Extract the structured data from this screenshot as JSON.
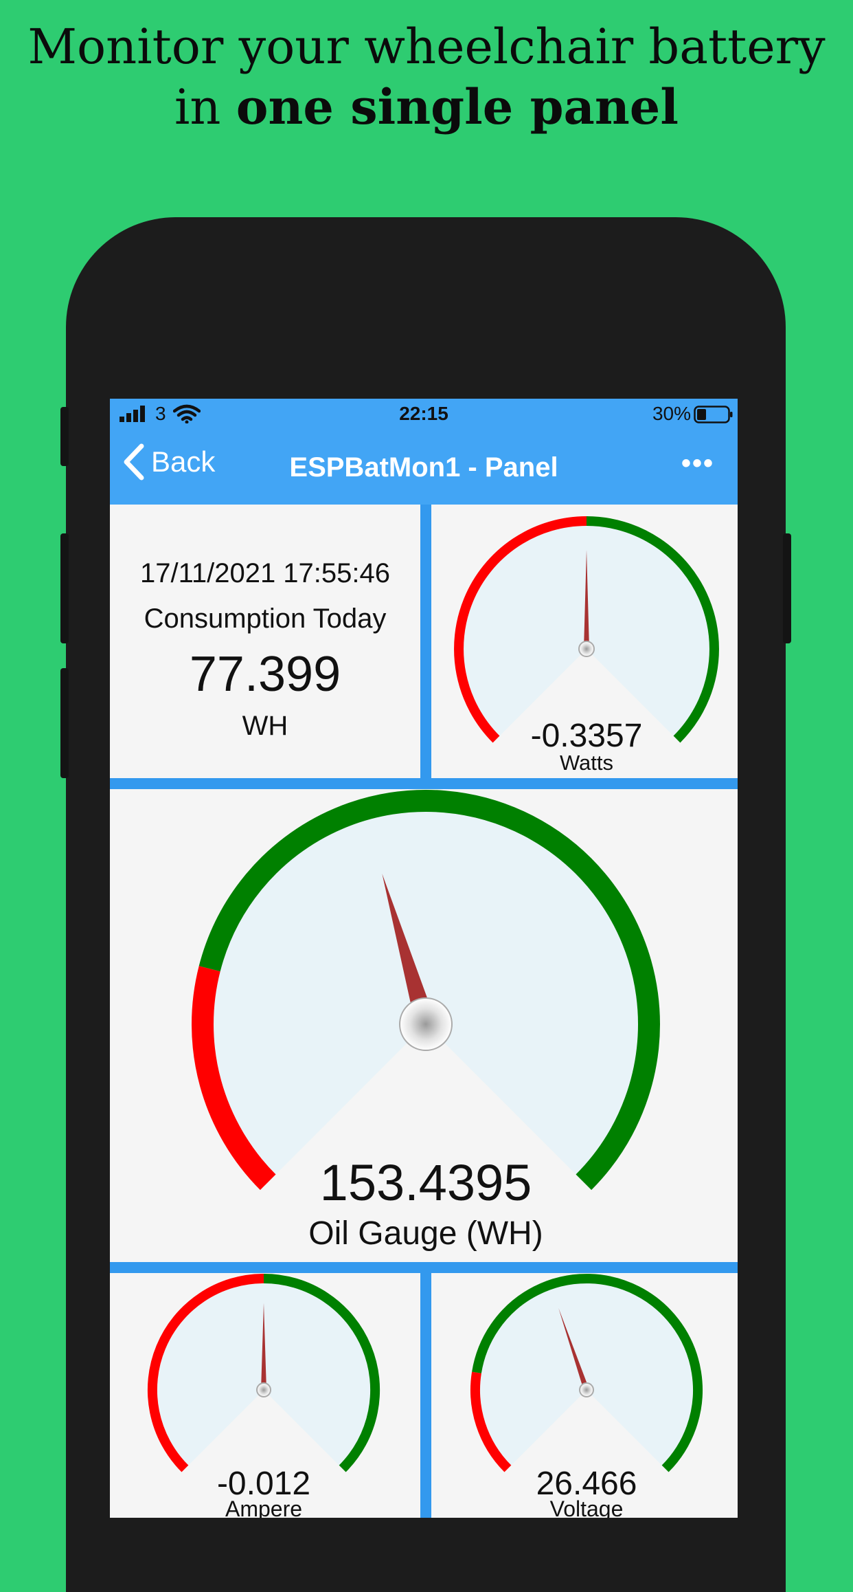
{
  "headline": {
    "line1": "Monitor your wheelchair battery",
    "line2_prefix": "in ",
    "line2_bold": "one single panel"
  },
  "status_bar": {
    "carrier": "3",
    "time": "22:15",
    "battery_percent": "30%"
  },
  "nav_bar": {
    "back_label": "Back",
    "title": "ESPBatMon1 - Panel",
    "more_label": "•••"
  },
  "consumption_tile": {
    "datetime": "17/11/2021 17:55:46",
    "label": "Consumption Today",
    "value": "77.399",
    "unit": "WH"
  },
  "gauges": {
    "watts": {
      "value": "-0.3357",
      "label": "Watts",
      "needle_fraction": 0.5,
      "red_fraction": 0.5
    },
    "oil": {
      "value": "153.4395",
      "label": "Oil Gauge (WH)",
      "needle_fraction": 0.44,
      "red_fraction": 0.22
    },
    "ampere": {
      "value": "-0.012",
      "label": "Ampere",
      "needle_fraction": 0.5,
      "red_fraction": 0.5
    },
    "voltage": {
      "value": "26.466",
      "label": "Voltage",
      "needle_fraction": 0.43,
      "red_fraction": 0.2
    }
  },
  "colors": {
    "background": "#2ecc71",
    "bar": "#42a5f5",
    "red_zone": "#ff0000",
    "green_zone": "#008000",
    "needle": "#a83232",
    "dial_face": "#e8f3f8"
  }
}
